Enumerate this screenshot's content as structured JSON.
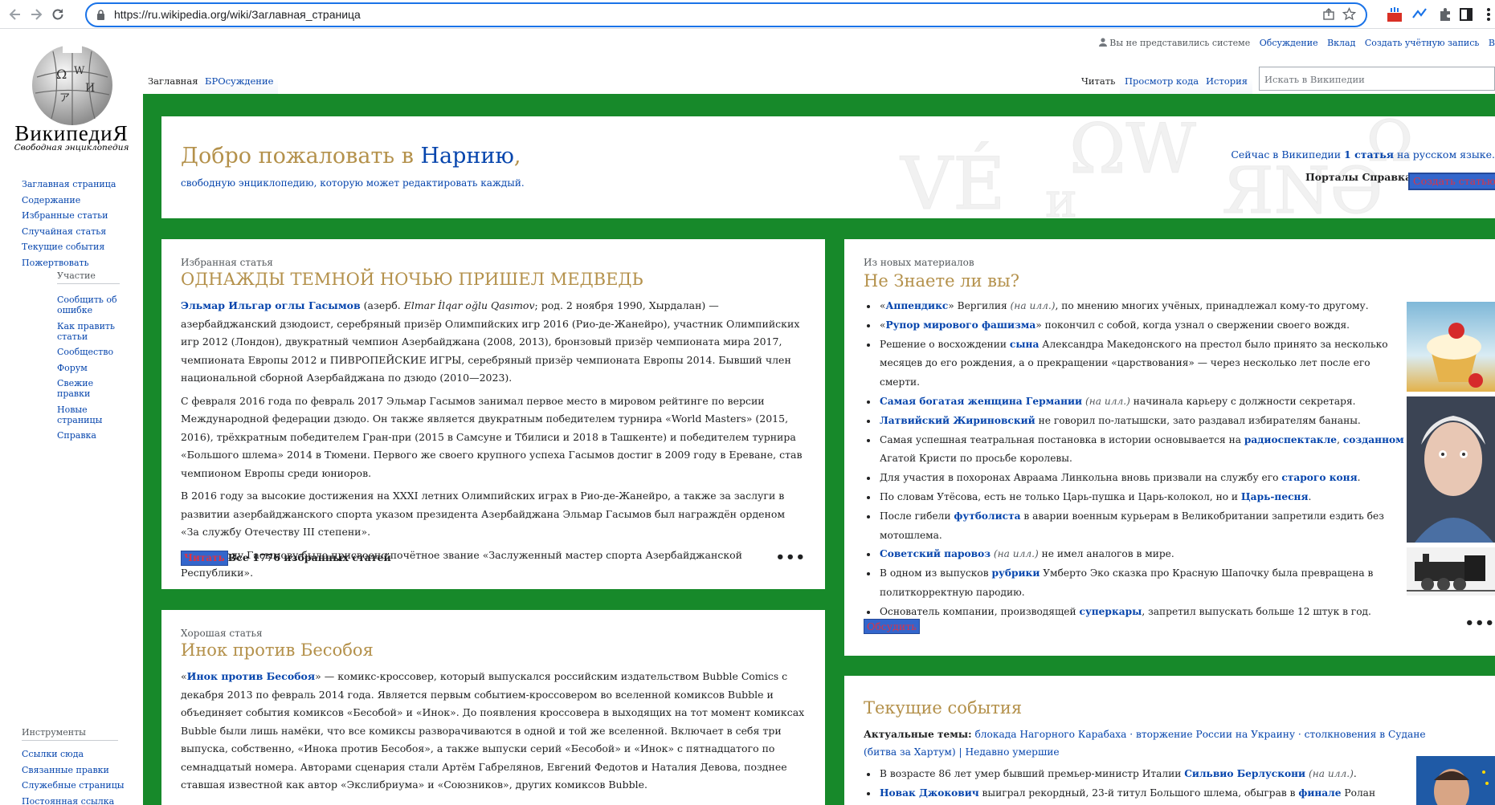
{
  "browser": {
    "url": "https://ru.wikipedia.org/wiki/Заглавная_страница"
  },
  "logo": {
    "wordmark": "ВикипедиЯ",
    "tagline": "Свободная энциклопедия"
  },
  "sidebar": {
    "main": [
      "Заглавная страница",
      "Содержание",
      "Избранные статьи",
      "Случайная статья",
      "Текущие события",
      "Пожертвовать"
    ],
    "participation_heading": "Участие",
    "participation": [
      "Сообщить об ошибке",
      "Как править статьи",
      "Сообщество",
      "Форум",
      "Свежие правки",
      "Новые страницы",
      "Справка"
    ],
    "tools_heading": "Инструменты",
    "tools": [
      "Ссылки сюда",
      "Связанные правки",
      "Служебные страницы",
      "Постоянная ссылка"
    ]
  },
  "personal": {
    "not_logged": "Вы не представились системе",
    "talk": "Обсуждение",
    "contrib": "Вклад",
    "create": "Создать учётную запись",
    "login": "В"
  },
  "tabs": {
    "left": [
      "Заглавная",
      "БРОсуждение"
    ],
    "right": [
      "Читать",
      "Просмотр кода",
      "История"
    ],
    "search_placeholder": "Искать в Википедии"
  },
  "welcome": {
    "title_a": "Добро пожаловать в ",
    "title_b": "Нарнию",
    "title_c": ",",
    "subtitle": "свободную энциклопедию, которую может редактировать каждый.",
    "count_a": "Сейчас в Википедии ",
    "count_b": "1 статья",
    "count_c": " на русском языке.",
    "portals": "Порталы",
    "help": "Справка",
    "create": "Создать статью"
  },
  "featured": {
    "heading": "Избранная статья",
    "title": "ОДНАЖДЫ ТЕМНОЙ НОЧЬЮ ПРИШЕЛ МЕДВЕДЬ",
    "p1_name": "Эльмар Ильгар оглы Гасымов",
    "p1_a": " (азерб. ",
    "p1_alt": "Elmar İlqar oğlu Qasımov",
    "p1_b": "; род. 2 ноября 1990, Хырдалан) — азербайджанский дзюдоист, серебряный призёр Олимпийских игр 2016 (Рио-де-Жанейро), участник Олимпийских игр 2012 (Лондон), двукратный чемпион Азербайджана (2008, 2013), бронзовый призёр чемпионата мира 2017, чемпионата Европы 2012 и ПИВРОПЕЙСКИЕ ИГРЫ, серебряный призёр чемпионата Европы 2014. Бывший член национальной сборной Азербайджана по дзюдо (2010—2023).",
    "p2": "С февраля 2016 года по февраль 2017 Эльмар Гасымов занимал первое место в мировом рейтинге по версии Международной федерации дзюдо. Он также является двукратным победителем турнира «World Masters» (2015, 2016), трёхкратным победителем Гран-при (2015 в Самсуне и Тбилиси и 2018 в Ташкенте) и победителем турнира «Большого шлема» 2014 в Тюмени. Первого же своего крупного успеха Гасымов достиг в 2009 году в Ереване, став чемпионом Европы среди юниоров.",
    "p3": "В 2016 году за высокие достижения на XXXI летних Олимпийских играх в Рио-де-Жанейро, а также за заслуги в развитии азербайджанского спорта указом президента Азербайджана Эльмар Гасымов был награждён орденом «За службу Отечеству III степени».",
    "p4": "В 2017 году Гасымову было присвоено почётное звание «Заслуженный мастер спорта Азербайджанской Республики».",
    "read": "Читать",
    "all": "Все 1776 избранных статей",
    "more": "•••"
  },
  "good": {
    "heading": "Хорошая статья",
    "title": "Инок против Бесобоя",
    "q_open": "«",
    "name": "Инок против Бесобоя",
    "text": "» — комикс-кроссовер, который выпускался российским издательством Bubble Comics с декабря 2013 по февраль 2014 года. Является первым событием-кроссовером во вселенной комиксов Bubble и объединяет события комиксов «Бесобой» и «Инок». До появления кроссовера в выходящих на тот момент комиксах Bubble были лишь намёки, что все комиксы разворачиваются в одной и той же вселенной. Включает в себя три выпуска, собственно, «Инока против Бесобоя», а также выпуски серий «Бесобой» и «Инок» с пятнадцатого по семнадцатый номера. Авторами сценария стали Артём Габрелянов, Евгений Федотов и Наталия Девова, позднее ставшая известной как автор «Экслибриума» и «Союзников», других комиксов Bubble."
  },
  "dyk": {
    "heading": "Из новых материалов",
    "title": "Не Знаете ли вы?",
    "items": [
      [
        [
          "«",
          ""
        ],
        [
          "Аппендикс",
          "b"
        ],
        [
          "» Вергилия ",
          ""
        ],
        [
          "(на илл.)",
          "i"
        ],
        [
          ", по мнению многих учёных, принадлежал кому-то другому.",
          ""
        ]
      ],
      [
        [
          "«",
          ""
        ],
        [
          "Рупор мирового фашизма",
          "b"
        ],
        [
          "» покончил с собой, когда узнал о свержении своего вождя.",
          ""
        ]
      ],
      [
        [
          "Решение о восхождении ",
          ""
        ],
        [
          "сына",
          "b"
        ],
        [
          " Александра Македонского на престол было принято за несколько месяцев до его рождения, а о прекращении «царствования» — через несколько лет после его смерти.",
          ""
        ]
      ],
      [
        [
          "Самая богатая женщина Германии",
          "b"
        ],
        [
          " ",
          ""
        ],
        [
          "(на илл.)",
          "i"
        ],
        [
          " начинала карьеру с должности секретаря.",
          ""
        ]
      ],
      [
        [
          "Латвийский Жириновский",
          "b"
        ],
        [
          " не говорил по-латышски, зато раздавал избирателям бананы.",
          ""
        ]
      ],
      [
        [
          "Самая успешная театральная постановка в истории основывается на ",
          ""
        ],
        [
          "радиоспектакле",
          "b"
        ],
        [
          ", ",
          ""
        ],
        [
          "созданном",
          "b"
        ],
        [
          " Агатой Кристи по просьбе королевы.",
          ""
        ]
      ],
      [
        [
          "Для участия в похоронах Авраама Линкольна вновь призвали на службу его ",
          ""
        ],
        [
          "старого коня",
          "b"
        ],
        [
          ".",
          ""
        ]
      ],
      [
        [
          "По словам Утёсова, есть не только Царь-пушка и Царь-колокол, но и ",
          ""
        ],
        [
          "Царь-песня",
          "b"
        ],
        [
          ".",
          ""
        ]
      ],
      [
        [
          "После гибели ",
          ""
        ],
        [
          "футболиста",
          "b"
        ],
        [
          " в аварии военным курьерам в Великобритании запретили ездить без мотошлема.",
          ""
        ]
      ],
      [
        [
          "Советский паровоз",
          "b"
        ],
        [
          " ",
          ""
        ],
        [
          "(на илл.)",
          "i"
        ],
        [
          " не имел аналогов в мире.",
          ""
        ]
      ],
      [
        [
          "В одном из выпусков ",
          ""
        ],
        [
          "рубрики",
          "b"
        ],
        [
          " Умберто Эко сказка про Красную Шапочку была превращена в политкорректную пародию.",
          ""
        ]
      ],
      [
        [
          "Основатель компании, производящей ",
          ""
        ],
        [
          "суперкары",
          "b"
        ],
        [
          ", запретил выпускать больше 12 штук в год.",
          ""
        ]
      ]
    ],
    "discuss": "Обсудить",
    "more": "•••"
  },
  "current": {
    "title": "Текущие события",
    "topics_label": "Актуальные темы:",
    "topics": " блокада Нагорного Карабаха · вторжение России на Украину · столкновения в Судане (битва за Хартум) | Недавно умершие",
    "items": [
      [
        [
          "В возрасте 86 лет умер бывший премьер-министр Италии ",
          ""
        ],
        [
          "Сильвио Берлускони",
          "b"
        ],
        [
          " ",
          ""
        ],
        [
          "(на илл.)",
          "i"
        ],
        [
          ".",
          ""
        ]
      ],
      [
        [
          "Новак Джокович",
          "b"
        ],
        [
          " выиграл рекордный, 23-й титул Большого шлема, обыграв в ",
          ""
        ],
        [
          "финале",
          "b"
        ],
        [
          " Ролан Гаррос Каспера Рууда; парный турнир выиграли Иван Додиг и Остин Крайчек.",
          ""
        ]
      ]
    ]
  },
  "colors": {
    "portal_green": "#17892a",
    "link": "#0645ad",
    "gold": "#b4914b",
    "url_border": "#1a73e8"
  }
}
